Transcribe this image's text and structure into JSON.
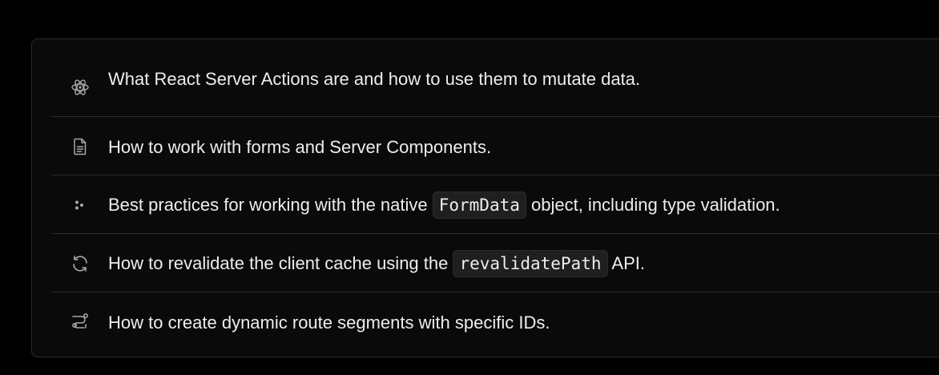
{
  "colors": {
    "page_background": "#000000",
    "card_background": "#0a0a0a",
    "divider": "#2b2b2b",
    "text": "#ededed",
    "icon": "#a8a8a8",
    "code_background": "#1f1f1f"
  },
  "items": [
    {
      "icon": "react-atom-icon",
      "text_before": "What React Server Actions are and how to use them to mutate data.",
      "code": "",
      "text_after": ""
    },
    {
      "icon": "document-icon",
      "text_before": "How to work with forms and Server Components.",
      "code": "",
      "text_after": ""
    },
    {
      "icon": "dots-icon",
      "text_before": "Best practices for working with the native ",
      "code": "FormData",
      "text_after": " object, including type validation."
    },
    {
      "icon": "refresh-icon",
      "text_before": "How to revalidate the client cache using the ",
      "code": "revalidatePath",
      "text_after": " API."
    },
    {
      "icon": "route-icon",
      "text_before": "How to create dynamic route segments with specific IDs.",
      "code": "",
      "text_after": ""
    }
  ]
}
